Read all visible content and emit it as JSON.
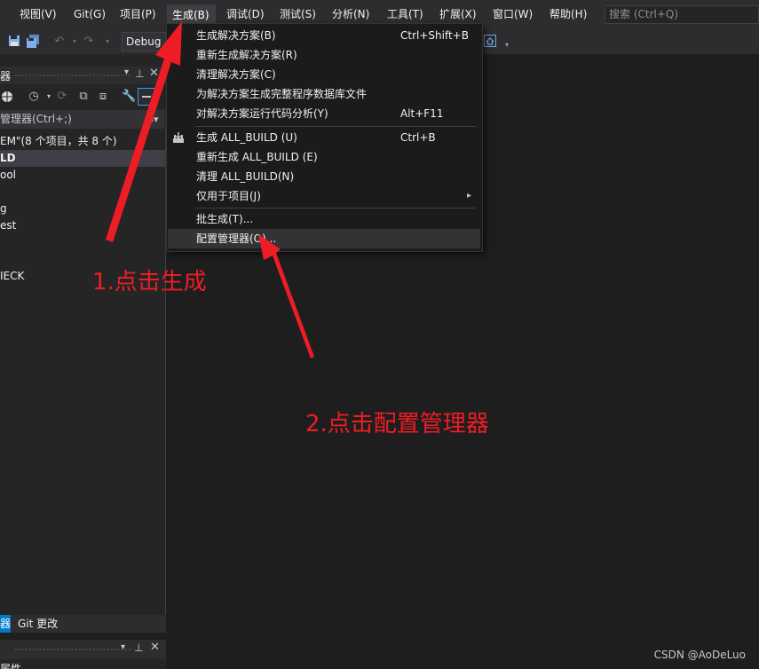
{
  "menubar": {
    "items": [
      "视图(V)",
      "Git(G)",
      "项目(P)",
      "生成(B)",
      "调试(D)",
      "测试(S)",
      "分析(N)",
      "工具(T)",
      "扩展(X)",
      "窗口(W)",
      "帮助(H)"
    ],
    "search_placeholder": "搜索 (Ctrl+Q)"
  },
  "toolbar": {
    "config": "Debug"
  },
  "explorer": {
    "title_fragment": "器",
    "search_placeholder": "管理器(Ctrl+;)",
    "tree": [
      "EM\"(8 个项目，共 8 个)",
      "LD",
      "ool",
      "g",
      "est",
      "IECK"
    ]
  },
  "bottom_tabs": [
    "器",
    "Git 更改"
  ],
  "properties": {
    "title_fragment": "属性"
  },
  "build_menu": {
    "items": [
      {
        "label": "生成解决方案(B)",
        "shortcut": "Ctrl+Shift+B"
      },
      {
        "label": "重新生成解决方案(R)",
        "shortcut": ""
      },
      {
        "label": "清理解决方案(C)",
        "shortcut": ""
      },
      {
        "label": "为解决方案生成完整程序数据库文件",
        "shortcut": ""
      },
      {
        "label": "对解决方案运行代码分析(Y)",
        "shortcut": "Alt+F11"
      },
      {
        "label": "生成 ALL_BUILD (U)",
        "shortcut": "Ctrl+B"
      },
      {
        "label": "重新生成 ALL_BUILD (E)",
        "shortcut": ""
      },
      {
        "label": "清理 ALL_BUILD(N)",
        "shortcut": ""
      },
      {
        "label": "仅用于项目(J)",
        "shortcut": ""
      },
      {
        "label": "批生成(T)...",
        "shortcut": ""
      },
      {
        "label": "配置管理器(O)...",
        "shortcut": ""
      }
    ]
  },
  "annotations": {
    "step1": "1.点击生成",
    "step2": "2.点击配置管理器"
  },
  "watermark": "CSDN @AoDeLuo",
  "colors": {
    "annotation": "#ee1c25",
    "accent": "#007acc",
    "background": "#1e1e1e"
  }
}
